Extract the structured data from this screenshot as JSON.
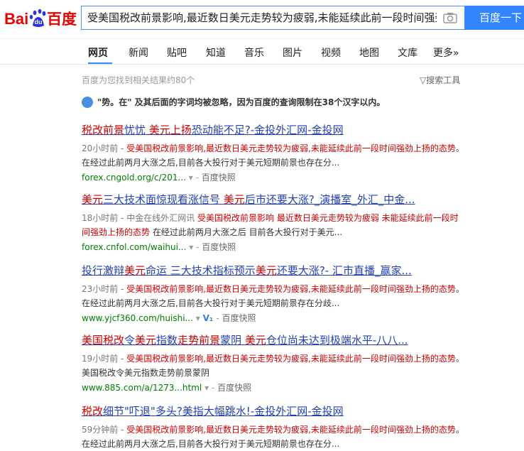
{
  "search": {
    "query": "受美国税改前景影响,最近数日美元走势较为疲弱,未能延续此前一段时间强劲上扬"
  },
  "header": {
    "search_button": "百度一下"
  },
  "tabs": [
    {
      "label": "网页"
    },
    {
      "label": "新闻"
    },
    {
      "label": "贴吧"
    },
    {
      "label": "知道"
    },
    {
      "label": "音乐"
    },
    {
      "label": "图片"
    },
    {
      "label": "视频"
    },
    {
      "label": "地图"
    },
    {
      "label": "文库"
    },
    {
      "label": "更多»"
    }
  ],
  "meta": {
    "count": "百度为您找到相关结果约80个",
    "tools": "▽搜索工具"
  },
  "hint": "\"势。在\" 及其后面的字词均被忽略，因为百度的查询限制在38个汉字以内。",
  "results": [
    {
      "title_parts": [
        {
          "t": "税改前景",
          "hl": true
        },
        {
          "t": "忧忧 ",
          "hl": false
        },
        {
          "t": "美元上扬",
          "hl": true
        },
        {
          "t": "恐动能不足?-金投外汇网-金投网",
          "hl": false
        }
      ],
      "time": "20小时前 -",
      "abstract_red": " 受美国税改前景影响,最近数日美元走势较为疲弱,未能延续此前一段时间强劲上扬的态势",
      "abstract_rest": "。在经过此前两月大涨之后,目前各大投行对于美元短期前景也存在分...",
      "url": "forex.cngold.org/c/201...",
      "has_v1": false,
      "snap": "百度快照"
    },
    {
      "title_parts": [
        {
          "t": "美元",
          "hl": true
        },
        {
          "t": "三大技术面惊现看涨信号 ",
          "hl": false
        },
        {
          "t": "美元",
          "hl": true
        },
        {
          "t": "后市还要大涨?_演播室_外汇_中金...",
          "hl": false
        }
      ],
      "time": "18小时前 - 中金在线外汇网讯",
      "abstract_red": " 受美国税改前景影响 最近数日美元走势较为疲弱 未能延续此前一段时间强劲上扬的态势",
      "abstract_rest": " 在经过此前两月大涨之后 目前各大投行对于美元...",
      "url": "forex.cnfol.com/waihui...",
      "has_v1": false,
      "snap": "百度快照"
    },
    {
      "title_parts": [
        {
          "t": "投行激辩",
          "hl": false
        },
        {
          "t": "美元",
          "hl": true
        },
        {
          "t": "命运 三大技术指标预示",
          "hl": false
        },
        {
          "t": "美元",
          "hl": true
        },
        {
          "t": "还要大涨?- 汇市直播_赢家...",
          "hl": false
        }
      ],
      "time": "23小时前 -",
      "abstract_red": " 受美国税改前景影响,最近数日美元走势较为疲弱,未能延续此前一段时间强劲上扬的态势",
      "abstract_rest": "。在经过此前两月大涨之后,目前各大投行对于美元短期前景存在分歧...",
      "url": "www.yjcf360.com/huishi...",
      "has_v1": true,
      "snap": "百度快照"
    },
    {
      "title_parts": [
        {
          "t": "美国税改",
          "hl": true
        },
        {
          "t": "令",
          "hl": false
        },
        {
          "t": "美元",
          "hl": true
        },
        {
          "t": "指数",
          "hl": false
        },
        {
          "t": "走势前景",
          "hl": true
        },
        {
          "t": "蒙阴 ",
          "hl": false
        },
        {
          "t": "美元",
          "hl": true
        },
        {
          "t": "仓位尚未达到极端水平-八八...",
          "hl": false
        }
      ],
      "time": "19小时前 -",
      "abstract_red": " 受美国税改前景影响,最近数日美元走势较为疲弱,未能延续此前一段时间强劲上扬的态势",
      "abstract_rest": "。美国税改令美元指数走势前景蒙阴",
      "url": "www.885.com/a/1273...html",
      "has_v1": false,
      "snap": "百度快照"
    },
    {
      "title_parts": [
        {
          "t": "税改",
          "hl": true
        },
        {
          "t": "细节\"吓退\"多头?美指大幅跳水!-金投外汇网-金投网",
          "hl": false
        }
      ],
      "time": "59分钟前 -",
      "abstract_red": " 受美国税改前景影响,最近数日美元走势较为疲弱,未能延续此前一段时间强劲上扬的态势",
      "abstract_rest": "。在经过此前两月大涨之后,目前各大投行对于美元短期前景也存在分...",
      "url": "",
      "has_v1": false,
      "snap": ""
    }
  ]
}
